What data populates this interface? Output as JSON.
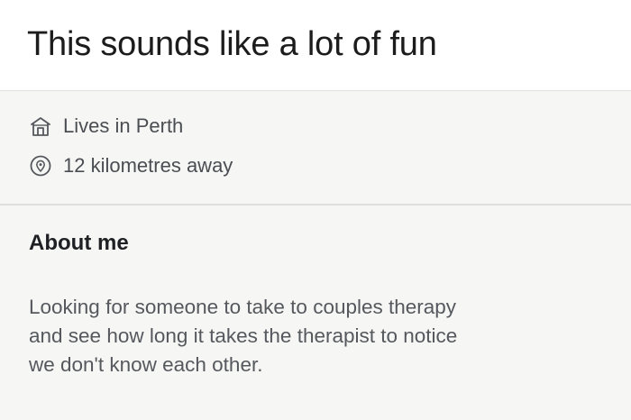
{
  "caption": "This sounds like a lot of fun",
  "profile": {
    "location": {
      "icon": "home-icon",
      "text": "Lives in Perth"
    },
    "distance": {
      "icon": "location-pin-icon",
      "text": "12 kilometres away"
    },
    "about": {
      "title": "About me",
      "lines": [
        "Looking for someone to take to couples therapy",
        "and see how  long it takes the therapist to notice",
        "we don't know each other."
      ]
    }
  }
}
